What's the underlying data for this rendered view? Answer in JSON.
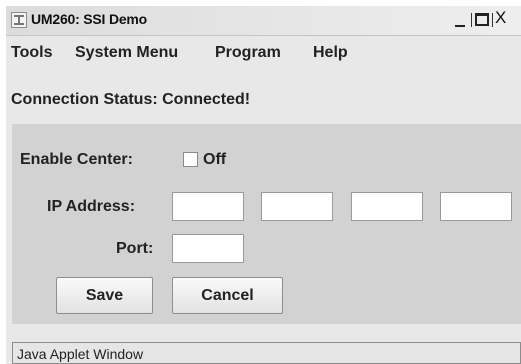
{
  "window": {
    "title": "UM260: SSI Demo",
    "controls": {
      "minimize": "_",
      "close": "X"
    }
  },
  "menubar": {
    "items": [
      {
        "label": "Tools"
      },
      {
        "label": "System Menu"
      },
      {
        "label": "Program"
      },
      {
        "label": "Help"
      }
    ]
  },
  "connection": {
    "status_text": "Connection Status: Connected!"
  },
  "form": {
    "enable_center": {
      "label": "Enable Center:",
      "checked": false,
      "state_text": "Off"
    },
    "ip_address": {
      "label": "IP Address:",
      "octets": [
        "",
        "",
        "",
        ""
      ]
    },
    "port": {
      "label": "Port:",
      "value": ""
    },
    "save_label": "Save",
    "cancel_label": "Cancel"
  },
  "status_bar": {
    "text": "Java Applet Window"
  },
  "icons": {
    "app": "java-cup-icon"
  },
  "colors": {
    "panel": "#d2d2d2",
    "window": "#e8e8e8"
  }
}
